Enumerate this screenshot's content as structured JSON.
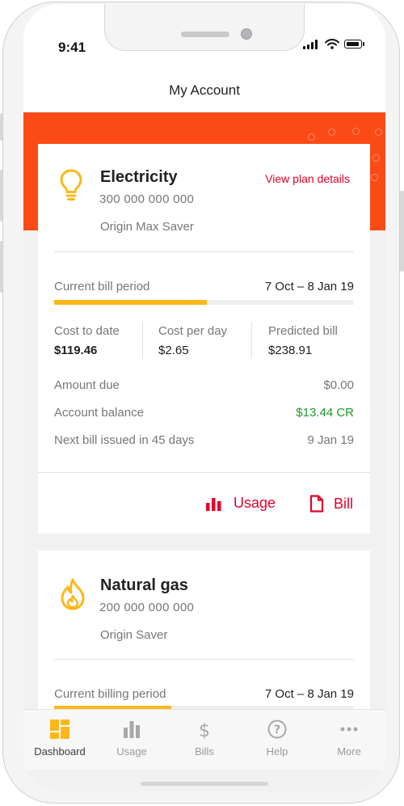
{
  "status_bar": {
    "time": "9:41"
  },
  "header": {
    "title": "My Account"
  },
  "electricity": {
    "name": "Electricity",
    "account_number": "300 000 000 000",
    "plan": "Origin Max Saver",
    "view_plan_label": "View plan details",
    "bill_period_label": "Current bill period",
    "bill_period_dates": "7 Oct – 8 Jan 19",
    "bill_period_progress_percent": 51,
    "cost_to_date_label": "Cost to date",
    "cost_to_date_value": "$119.46",
    "cost_per_day_label": "Cost per day",
    "cost_per_day_value": "$2.65",
    "predicted_bill_label": "Predicted bill",
    "predicted_bill_value": "$238.91",
    "amount_due_label": "Amount due",
    "amount_due_value": "$0.00",
    "account_balance_label": "Account balance",
    "account_balance_value": "$13.44 CR",
    "next_bill_label": "Next bill issued in 45 days",
    "next_bill_date": "9 Jan 19",
    "usage_label": "Usage",
    "bill_label": "Bill"
  },
  "gas": {
    "name": "Natural gas",
    "account_number": "200 000 000 000",
    "plan": "Origin Saver",
    "bill_period_label": "Current billing period",
    "bill_period_dates": "7 Oct – 8 Jan 19"
  },
  "tab_bar": {
    "items": [
      {
        "label": "Dashboard",
        "icon": "dashboard-icon",
        "active": true
      },
      {
        "label": "Usage",
        "icon": "usage-icon",
        "active": false
      },
      {
        "label": "Bills",
        "icon": "dollar-icon",
        "active": false
      },
      {
        "label": "Help",
        "icon": "help-icon",
        "active": false
      },
      {
        "label": "More",
        "icon": "more-icon",
        "active": false
      }
    ]
  },
  "colors": {
    "brand": "#fa4b16",
    "accent": "#fdb71a",
    "link": "#e4002b",
    "credit": "#1a9a2a"
  }
}
